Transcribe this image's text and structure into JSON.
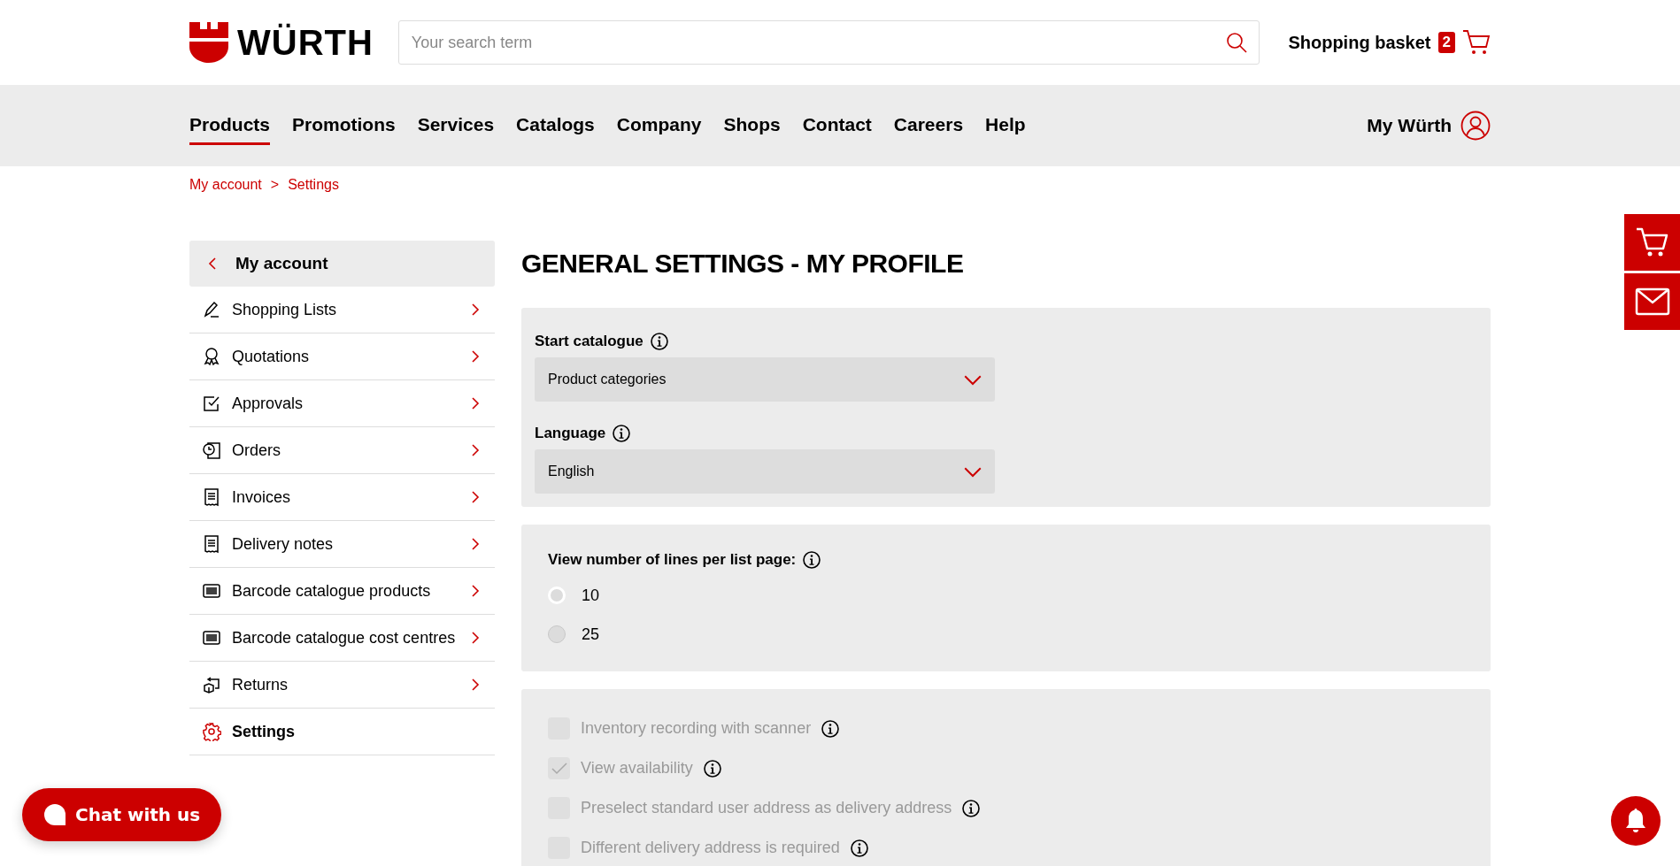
{
  "header": {
    "logo_text": "WÜRTH",
    "search": {
      "placeholder": "Your search term"
    },
    "basket": {
      "label": "Shopping basket",
      "count": "2"
    }
  },
  "nav": {
    "items": [
      {
        "label": "Products",
        "selected": true
      },
      {
        "label": "Promotions",
        "selected": false
      },
      {
        "label": "Services",
        "selected": false
      },
      {
        "label": "Catalogs",
        "selected": false
      },
      {
        "label": "Company",
        "selected": false
      },
      {
        "label": "Shops",
        "selected": false
      },
      {
        "label": "Contact",
        "selected": false
      },
      {
        "label": "Careers",
        "selected": false
      },
      {
        "label": "Help",
        "selected": false
      }
    ],
    "account": "My Würth"
  },
  "breadcrumb": {
    "separator": ">",
    "items": [
      "My account",
      "Settings"
    ]
  },
  "sidebar": {
    "title": "My account",
    "items": [
      {
        "label": "Shopping Lists",
        "selected": false
      },
      {
        "label": "Quotations",
        "selected": false
      },
      {
        "label": "Approvals",
        "selected": false
      },
      {
        "label": "Orders",
        "selected": false
      },
      {
        "label": "Invoices",
        "selected": false
      },
      {
        "label": "Delivery notes",
        "selected": false
      },
      {
        "label": "Barcode catalogue products",
        "selected": false
      },
      {
        "label": "Barcode catalogue cost centres",
        "selected": false
      },
      {
        "label": "Returns",
        "selected": false
      },
      {
        "label": "Settings",
        "selected": true
      }
    ]
  },
  "page_title": "GENERAL SETTINGS - MY PROFILE",
  "selects": [
    {
      "label": "Start catalogue",
      "value": "Product categories"
    },
    {
      "label": "Language",
      "value": "English"
    }
  ],
  "lines_per_page": {
    "label": "View number of lines per list page:",
    "options": [
      {
        "label": "10",
        "selected": true
      },
      {
        "label": "25",
        "selected": false
      }
    ]
  },
  "options": [
    {
      "label": "Inventory recording with scanner",
      "checked": false,
      "disabled": true
    },
    {
      "label": "View availability",
      "checked": true,
      "disabled": true
    },
    {
      "label": "Preselect standard user address as delivery address",
      "checked": false,
      "disabled": true
    },
    {
      "label": "Different delivery address is required",
      "checked": false,
      "disabled": true
    }
  ],
  "chat": {
    "label": "Chat with us"
  }
}
